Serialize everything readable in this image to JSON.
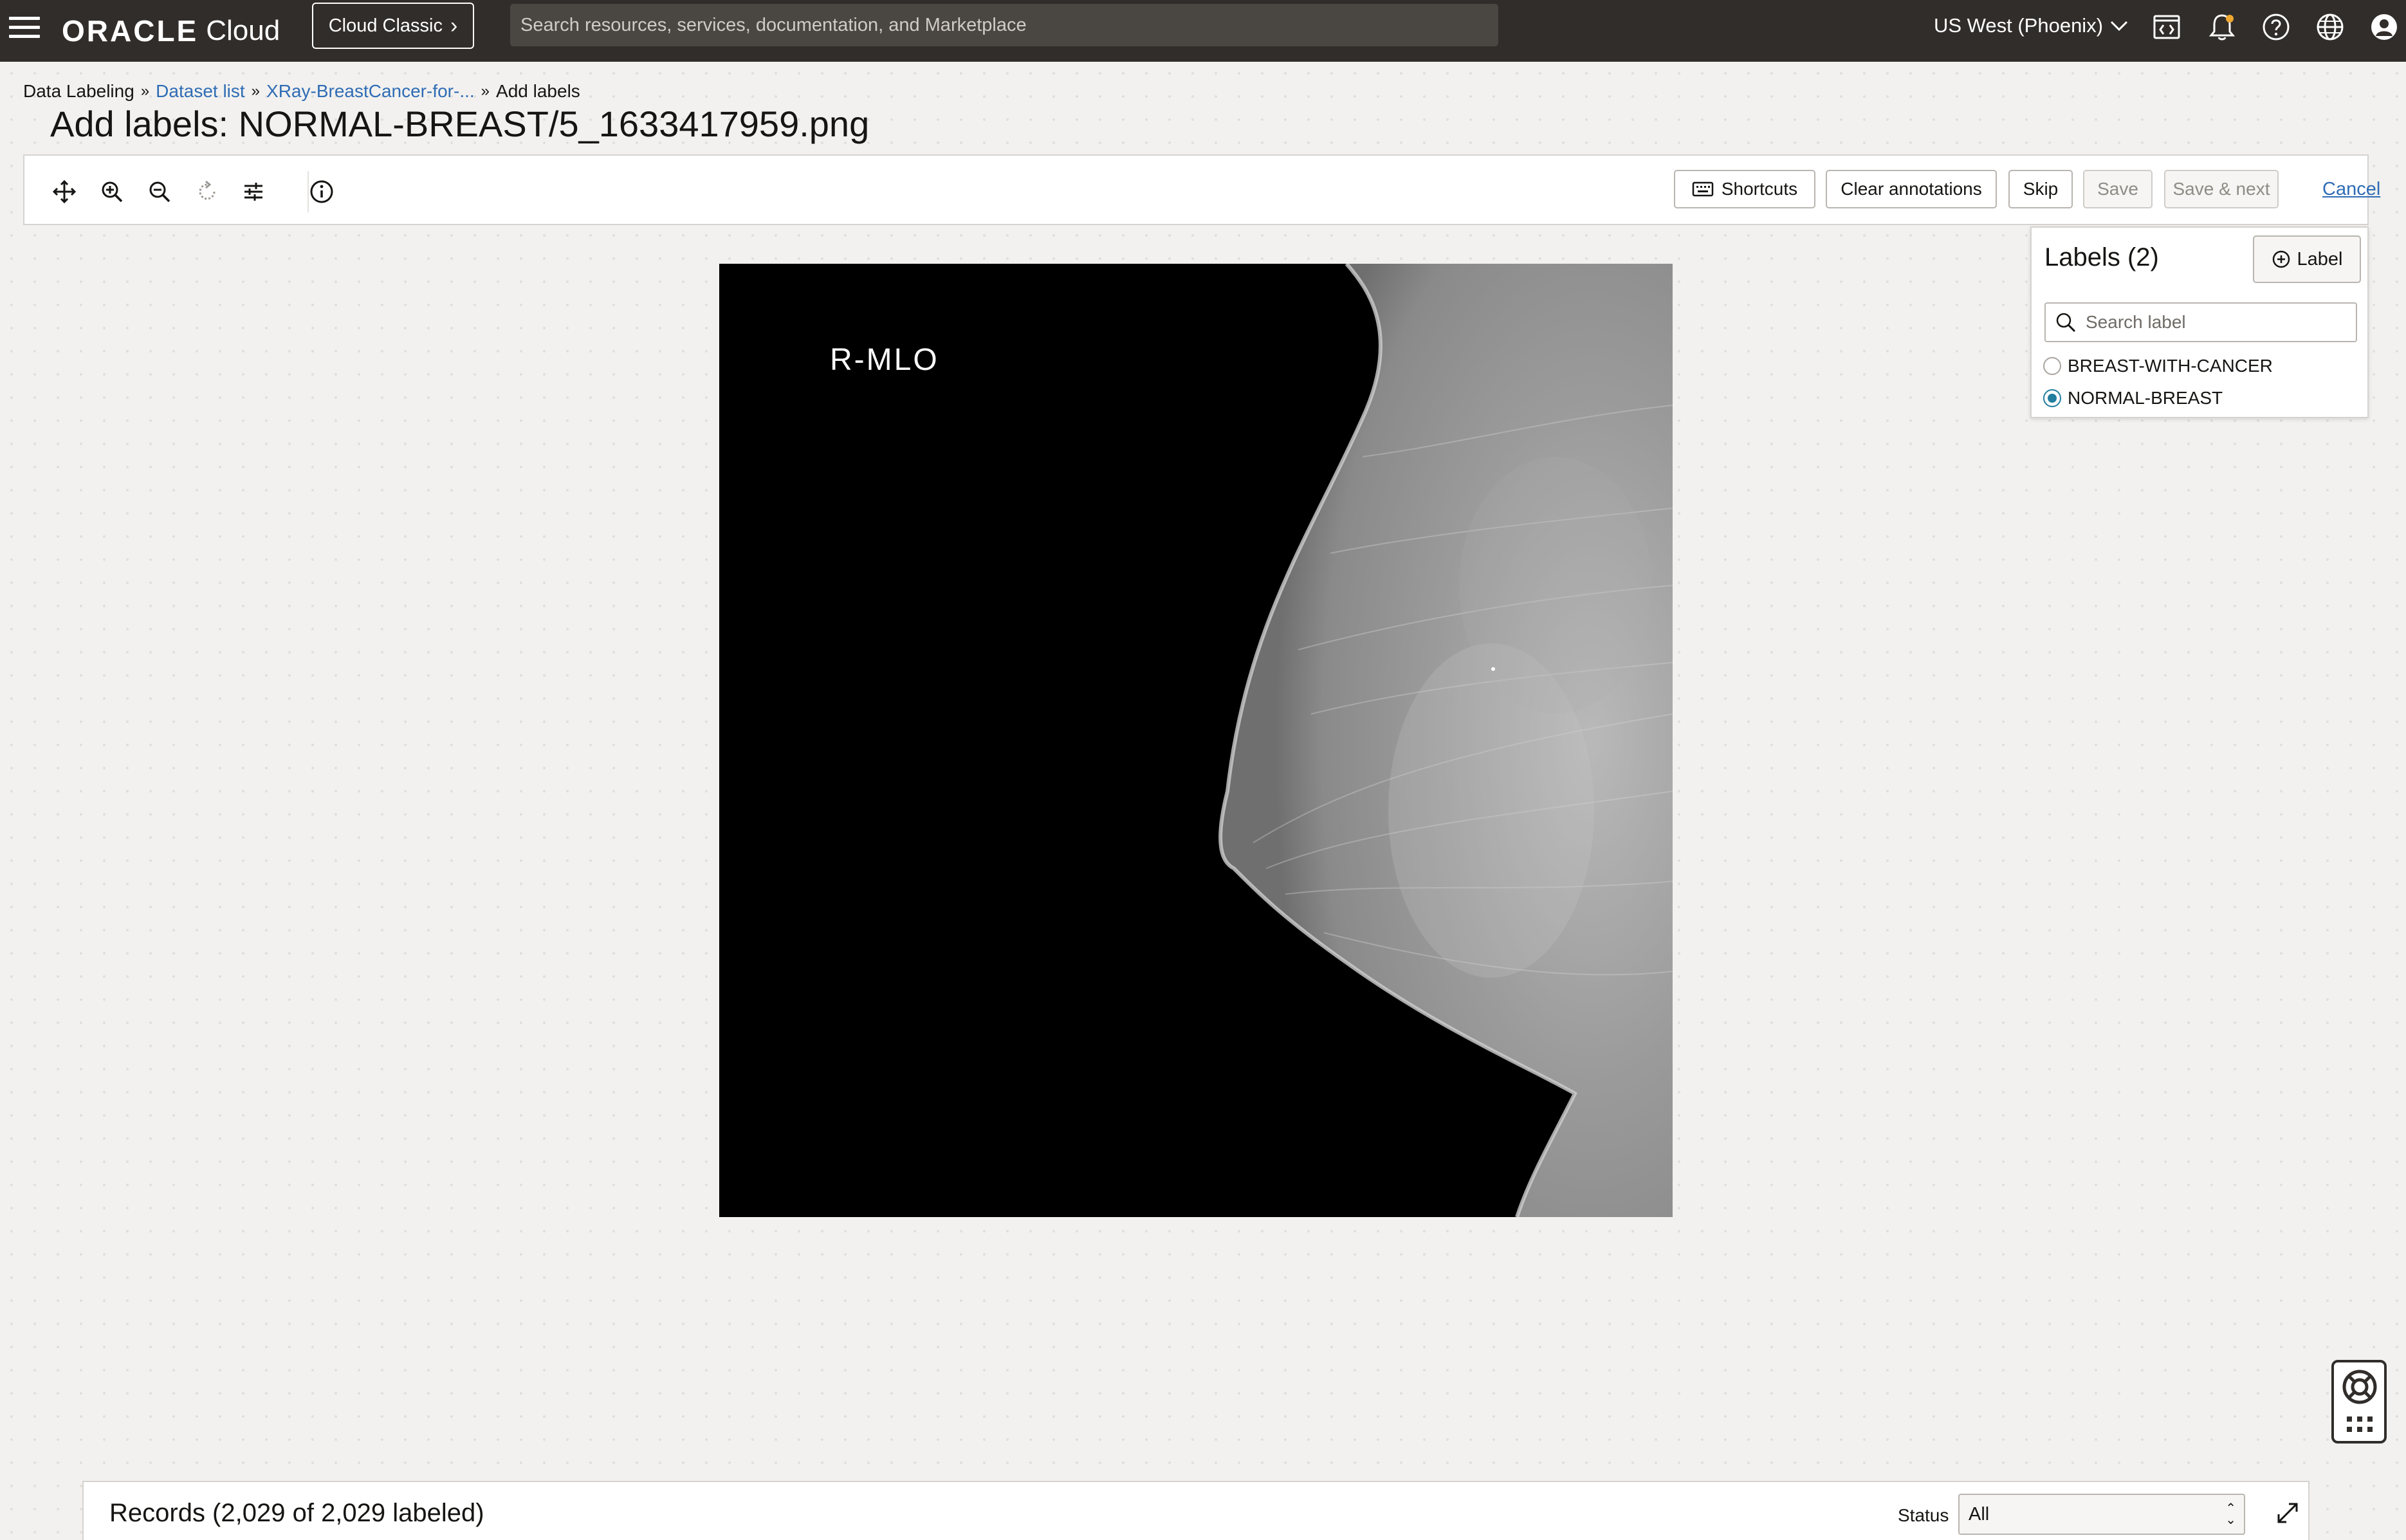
{
  "topbar": {
    "brand": "ORACLE",
    "brand_suffix": "Cloud",
    "classic_button": "Cloud Classic",
    "search_placeholder": "Search resources, services, documentation, and Marketplace",
    "region": "US West (Phoenix)"
  },
  "breadcrumb": {
    "items": [
      "Data Labeling",
      "Dataset list",
      "XRay-BreastCancer-for-...",
      "Add labels"
    ],
    "separator": "»"
  },
  "page": {
    "title": "Add labels: NORMAL-BREAST/5_1633417959.png"
  },
  "toolbar": {
    "tools": [
      "move-icon",
      "zoom-in-icon",
      "zoom-out-icon",
      "reset-icon",
      "adjust-icon",
      "info-icon"
    ],
    "shortcuts_label": "Shortcuts",
    "clear_label": "Clear annotations",
    "skip_label": "Skip",
    "save_label": "Save",
    "save_next_label": "Save & next",
    "cancel_label": "Cancel"
  },
  "image": {
    "view_label": "R-MLO"
  },
  "labels_panel": {
    "title": "Labels (2)",
    "add_button": "Label",
    "search_placeholder": "Search label",
    "options": [
      {
        "name": "BREAST-WITH-CANCER",
        "selected": false
      },
      {
        "name": "NORMAL-BREAST",
        "selected": true
      }
    ]
  },
  "records": {
    "title": "Records (2,029 of 2,029 labeled)",
    "status_label": "Status",
    "status_value": "All"
  },
  "colors": {
    "topbar": "#312d2a",
    "link": "#2f6cb5",
    "radio_selected": "#227e9e"
  }
}
